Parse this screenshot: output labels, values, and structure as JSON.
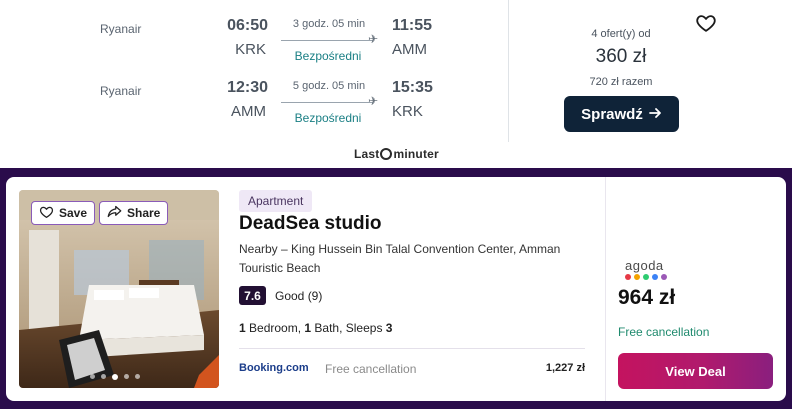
{
  "flight": {
    "legs": [
      {
        "airline": "Ryanair",
        "dep_time": "06:50",
        "dep_code": "KRK",
        "duration": "3 godz. 05 min",
        "stops": "Bezpośredni",
        "arr_time": "11:55",
        "arr_code": "AMM"
      },
      {
        "airline": "Ryanair",
        "dep_time": "12:30",
        "dep_code": "AMM",
        "duration": "5 godz. 05 min",
        "stops": "Bezpośredni",
        "arr_time": "15:35",
        "arr_code": "KRK"
      }
    ],
    "offers_count": "4 ofert(y) od",
    "price": "360 zł",
    "price_total": "720 zł razem",
    "check_label": "Sprawdź",
    "provider": {
      "part1": "Last",
      "part2": "minuter"
    }
  },
  "hotel": {
    "save_label": "Save",
    "share_label": "Share",
    "type": "Apartment",
    "name": "DeadSea studio",
    "location": "Nearby – King Hussein Bin Talal Convention Center, Amman Touristic Beach",
    "rating_score": "7.6",
    "rating_text": "Good (9)",
    "rooms": {
      "bedrooms_count": "1",
      "bedrooms_label": " Bedroom, ",
      "bath_count": "1",
      "bath_label": " Bath, Sleeps ",
      "sleeps_count": "3"
    },
    "booking": {
      "logo": "Booking.com",
      "free_cancellation": "Free cancellation",
      "price": "1,227 zł"
    },
    "best_deal": {
      "provider": "agoda",
      "price": "964 zł",
      "free_cancellation": "Free cancellation",
      "button_label": "View Deal"
    },
    "photo_dots": {
      "count": 5,
      "active": 3
    }
  },
  "colors": {
    "check_button_bg": "#0f2338",
    "band_bg": "#2a0c4b",
    "stops_text": "#1a7f84",
    "free_cancellation": "#1f8a6e",
    "agoda_dots": [
      "#e63946",
      "#f4a300",
      "#2ecc71",
      "#3b82f6",
      "#9b59b6"
    ]
  }
}
